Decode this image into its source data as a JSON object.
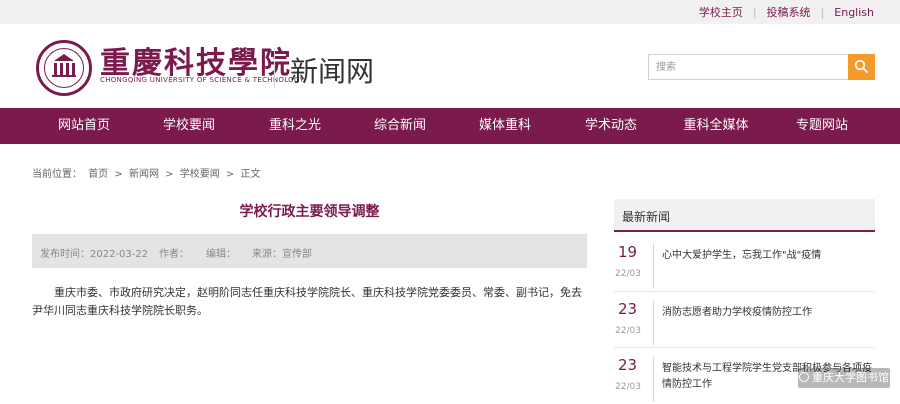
{
  "topbar": {
    "links": [
      "学校主页",
      "投稿系统",
      "English"
    ]
  },
  "header": {
    "logo_cn": "重慶科技學院",
    "logo_en": "CHONGQING UNIVERSITY OF SCIENCE & TECHNOLOGY",
    "site_name": "新闻网",
    "search_placeholder": "搜索"
  },
  "nav": {
    "items": [
      "网站首页",
      "学校要闻",
      "重科之光",
      "综合新闻",
      "媒体重科",
      "学术动态",
      "重科全媒体",
      "专题网站"
    ]
  },
  "breadcrumb": {
    "items": [
      "当前位置：",
      "首页",
      ">",
      "新闻网",
      ">",
      "学校要闻",
      ">",
      "正文"
    ]
  },
  "article": {
    "title": "学校行政主要领导调整",
    "publish": "发布时间：2022-03-22",
    "author": "作者：",
    "editor": "编辑：",
    "source": "来源：宣传部",
    "body": "重庆市委、市政府研究决定，赵明阶同志任重庆科技学院院长、重庆科技学院党委委员、常委、副书记，免去尹华川同志重庆科技学院院长职务。"
  },
  "sidebar": {
    "title": "最新新闻",
    "news": [
      {
        "day": "19",
        "month": "22/03",
        "text": "心中大爱护学生，忘我工作\"战\"疫情"
      },
      {
        "day": "23",
        "month": "22/03",
        "text": "消防志愿者助力学校疫情防控工作"
      },
      {
        "day": "23",
        "month": "22/03",
        "text": "智能技术与工程学院学生党支部积极参与各项疫情防控工作"
      }
    ]
  },
  "watermark": "重庆大学图书馆",
  "colors": {
    "brand": "#7a1a4d",
    "search_button": "#f39a2b"
  }
}
